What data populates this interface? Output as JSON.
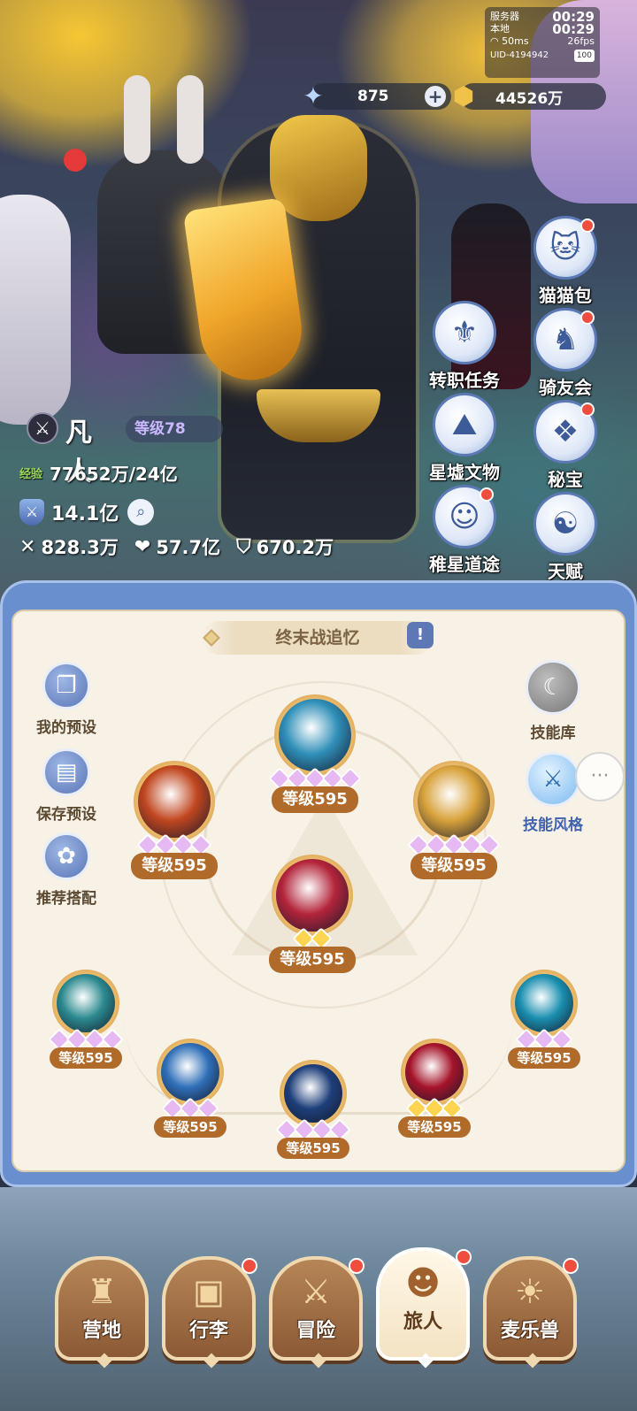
{
  "hud": {
    "server_label": "服务器",
    "server_time": "00:29",
    "local_label": "本地",
    "local_time": "00:29",
    "ping": "50ms",
    "fps": "26fps",
    "uid": "UID-4194942",
    "uid_badge": "100"
  },
  "currency": {
    "gems": "875",
    "gold": "44526万"
  },
  "side_menu": [
    {
      "label": "猫猫包",
      "icon": "cat-bag-icon",
      "badge": true
    },
    {
      "label": "转职任务",
      "icon": "job-change-icon",
      "badge": false
    },
    {
      "label": "骑友会",
      "icon": "horse-icon",
      "badge": true
    },
    {
      "label": "星墟文物",
      "icon": "relic-icon",
      "badge": false
    },
    {
      "label": "秘宝",
      "icon": "treasure-icon",
      "badge": true
    },
    {
      "label": "稚星道途",
      "icon": "star-path-icon",
      "badge": true
    },
    {
      "label": "天赋",
      "icon": "talent-icon",
      "badge": false
    }
  ],
  "player": {
    "name": "凡人",
    "level": "等级78",
    "exp_tag": "经验",
    "exp": "77652万/24亿",
    "power": "14.1亿",
    "attack": "828.3万",
    "hp": "57.7亿",
    "defense": "670.2万"
  },
  "panel": {
    "title": "终末战追忆",
    "info_icon": "!",
    "left_tools": [
      {
        "label": "我的预设",
        "icon": "preset-icon"
      },
      {
        "label": "保存预设",
        "icon": "save-icon"
      },
      {
        "label": "推荐搭配",
        "icon": "recommend-icon"
      }
    ],
    "right_tools": [
      {
        "label": "技能库",
        "icon": "skill-library-icon"
      },
      {
        "label": "技能风格",
        "icon": "skill-style-icon"
      }
    ],
    "skills": [
      {
        "level": "等级595",
        "stars": 5,
        "star_color": "purple",
        "theme": "#2f8fb8"
      },
      {
        "level": "等级595",
        "stars": 4,
        "star_color": "purple",
        "theme": "#c0461f"
      },
      {
        "level": "等级595",
        "stars": 5,
        "star_color": "purple",
        "theme": "#d8a23b"
      },
      {
        "level": "等级595",
        "stars": 2,
        "star_color": "gold",
        "theme": "#b3243a"
      },
      {
        "level": "等级595",
        "stars": 4,
        "star_color": "purple",
        "theme": "#2b8a8f"
      },
      {
        "level": "等级595",
        "stars": 3,
        "star_color": "purple",
        "theme": "#2f6fb8"
      },
      {
        "level": "等级595",
        "stars": 4,
        "star_color": "purple",
        "theme": "#1e3f7a"
      },
      {
        "level": "等级595",
        "stars": 3,
        "star_color": "gold",
        "theme": "#a5142a"
      },
      {
        "level": "等级595",
        "stars": 3,
        "star_color": "purple",
        "theme": "#1a8fb0"
      }
    ]
  },
  "bottom_nav": [
    {
      "label": "营地",
      "icon": "castle-icon",
      "badge": false,
      "active": false
    },
    {
      "label": "行李",
      "icon": "backpack-icon",
      "badge": true,
      "active": false
    },
    {
      "label": "冒险",
      "icon": "crossed-swords-icon",
      "badge": true,
      "active": false
    },
    {
      "label": "旅人",
      "icon": "traveler-icon",
      "badge": true,
      "active": true
    },
    {
      "label": "麦乐兽",
      "icon": "pet-icon",
      "badge": true,
      "active": false
    }
  ]
}
